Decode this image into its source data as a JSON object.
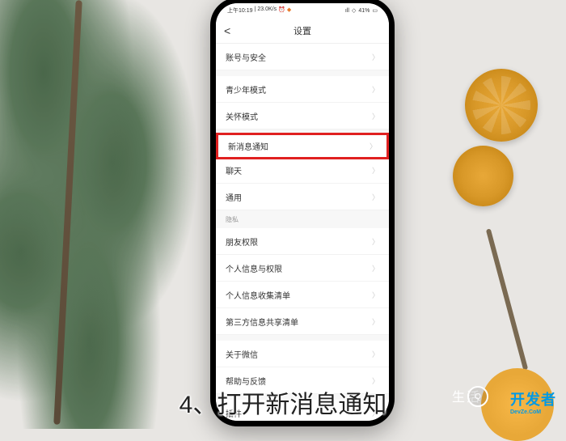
{
  "status_bar": {
    "time": "上午10:19",
    "speed": "23.0K/s",
    "alarm": "⏰",
    "battery": "41%"
  },
  "header": {
    "back": "<",
    "title": "设置"
  },
  "groups": [
    {
      "items": [
        {
          "label": "账号与安全"
        }
      ]
    },
    {
      "items": [
        {
          "label": "青少年模式"
        },
        {
          "label": "关怀模式"
        }
      ]
    },
    {
      "items": [
        {
          "label": "新消息通知",
          "highlighted": true
        },
        {
          "label": "聊天"
        },
        {
          "label": "通用"
        }
      ]
    },
    {
      "section_label": "隐私",
      "items": [
        {
          "label": "朋友权限"
        },
        {
          "label": "个人信息与权限"
        },
        {
          "label": "个人信息收集清单"
        },
        {
          "label": "第三方信息共享清单"
        }
      ]
    },
    {
      "items": [
        {
          "label": "关于微信"
        },
        {
          "label": "帮助与反馈"
        }
      ]
    },
    {
      "items": [
        {
          "label": "插件"
        }
      ]
    }
  ],
  "caption": "4、打开新消息通知",
  "watermark": {
    "brand": "开发者",
    "url": "DevZe.CoM",
    "life": "生活"
  }
}
